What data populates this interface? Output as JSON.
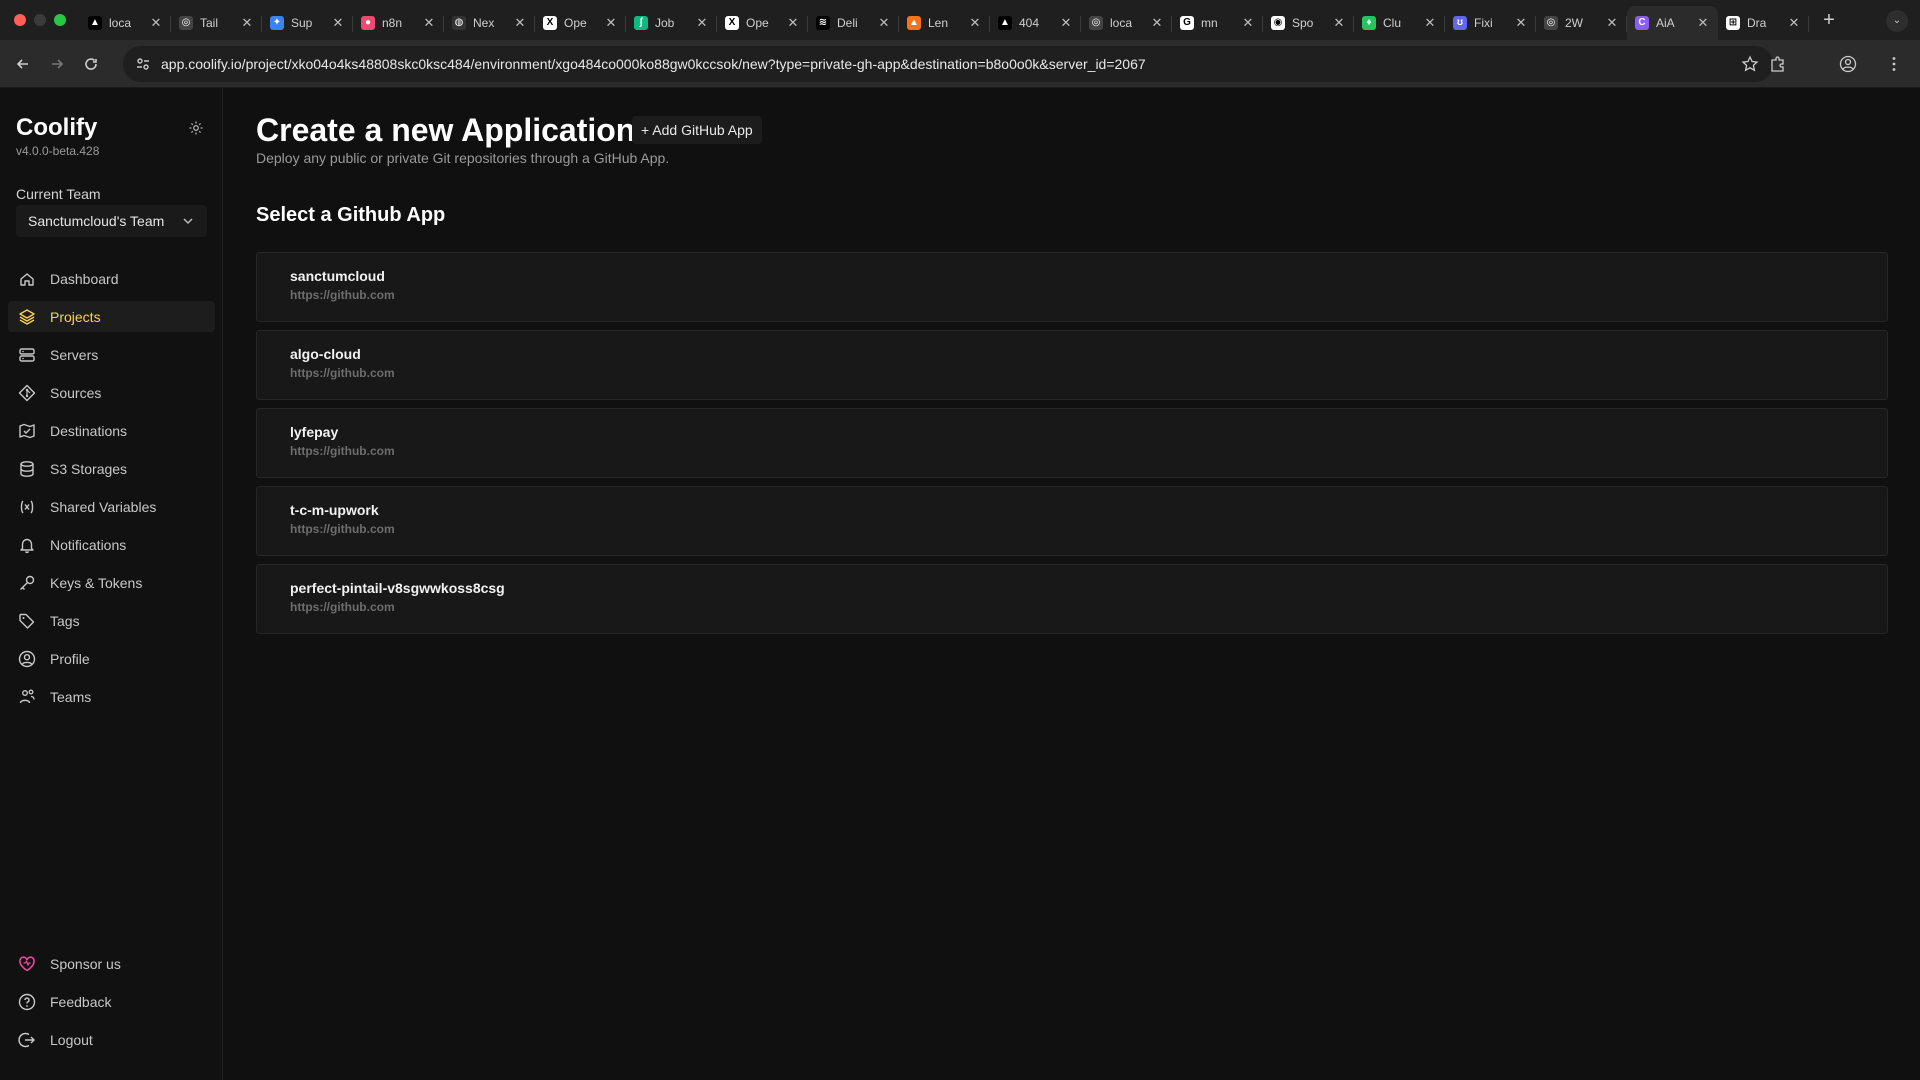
{
  "browser": {
    "tabs": [
      {
        "title": "loca",
        "favicon_color": "#000000",
        "glyph": "▲"
      },
      {
        "title": "Tail",
        "favicon_color": "#444444",
        "glyph": "◎"
      },
      {
        "title": "Sup",
        "favicon_color": "#3b82f6",
        "glyph": "✦"
      },
      {
        "title": "n8n",
        "favicon_color": "#ea4b71",
        "glyph": "●"
      },
      {
        "title": "Nex",
        "favicon_color": "#333333",
        "glyph": "◍"
      },
      {
        "title": "Ope",
        "favicon_color": "#ffffff",
        "glyph": "X"
      },
      {
        "title": "Job",
        "favicon_color": "#10b981",
        "glyph": "ʃ"
      },
      {
        "title": "Ope",
        "favicon_color": "#ffffff",
        "glyph": "X"
      },
      {
        "title": "Deli",
        "favicon_color": "#000000",
        "glyph": "≋"
      },
      {
        "title": "Len",
        "favicon_color": "#f97316",
        "glyph": "▲"
      },
      {
        "title": "404",
        "favicon_color": "#000000",
        "glyph": "▲"
      },
      {
        "title": "loca",
        "favicon_color": "#444444",
        "glyph": "◎"
      },
      {
        "title": "mn",
        "favicon_color": "#ffffff",
        "glyph": "G"
      },
      {
        "title": "Spo",
        "favicon_color": "#ffffff",
        "glyph": "◉"
      },
      {
        "title": "Clu",
        "favicon_color": "#22c55e",
        "glyph": "♦"
      },
      {
        "title": "Fixi",
        "favicon_color": "#6366f1",
        "glyph": "ʊ"
      },
      {
        "title": "2W",
        "favicon_color": "#444444",
        "glyph": "◎"
      },
      {
        "title": "AiA",
        "favicon_color": "#8b5cf6",
        "glyph": "C",
        "active": true
      },
      {
        "title": "Dra",
        "favicon_color": "#ffffff",
        "glyph": "⊞"
      }
    ],
    "url": "app.coolify.io/project/xko04o4ks48808skc0ksc484/environment/xgo484co000ko88gw0kccsok/new?type=private-gh-app&destination=b8o0o0k&server_id=2067"
  },
  "sidebar": {
    "brand": "Coolify",
    "version": "v4.0.0-beta.428",
    "team_label": "Current Team",
    "team_value": "Sanctumcloud's Team",
    "nav": [
      {
        "label": "Dashboard",
        "icon": "home-icon"
      },
      {
        "label": "Projects",
        "icon": "layers-icon",
        "active": true
      },
      {
        "label": "Servers",
        "icon": "server-icon"
      },
      {
        "label": "Sources",
        "icon": "git-icon"
      },
      {
        "label": "Destinations",
        "icon": "destination-icon"
      },
      {
        "label": "S3 Storages",
        "icon": "database-icon"
      },
      {
        "label": "Shared Variables",
        "icon": "variable-icon"
      },
      {
        "label": "Notifications",
        "icon": "bell-icon"
      },
      {
        "label": "Keys & Tokens",
        "icon": "key-icon"
      },
      {
        "label": "Tags",
        "icon": "tag-icon"
      },
      {
        "label": "Profile",
        "icon": "user-icon"
      },
      {
        "label": "Teams",
        "icon": "users-icon"
      }
    ],
    "bottom": [
      {
        "label": "Sponsor us",
        "icon": "heart-icon"
      },
      {
        "label": "Feedback",
        "icon": "help-icon"
      },
      {
        "label": "Logout",
        "icon": "logout-icon"
      }
    ]
  },
  "main": {
    "title": "Create a new Application",
    "add_button": "+ Add GitHub App",
    "subtitle": "Deploy any public or private Git repositories through a GitHub App.",
    "section_title": "Select a Github App",
    "apps": [
      {
        "name": "sanctumcloud",
        "host": "https://github.com"
      },
      {
        "name": "algo-cloud",
        "host": "https://github.com"
      },
      {
        "name": "lyfepay",
        "host": "https://github.com"
      },
      {
        "name": "t-c-m-upwork",
        "host": "https://github.com"
      },
      {
        "name": "perfect-pintail-v8sgwwkoss8csg",
        "host": "https://github.com"
      }
    ]
  },
  "colors": {
    "accent": "#fcd34d",
    "sponsor": "#ec4899",
    "background": "#101010"
  }
}
